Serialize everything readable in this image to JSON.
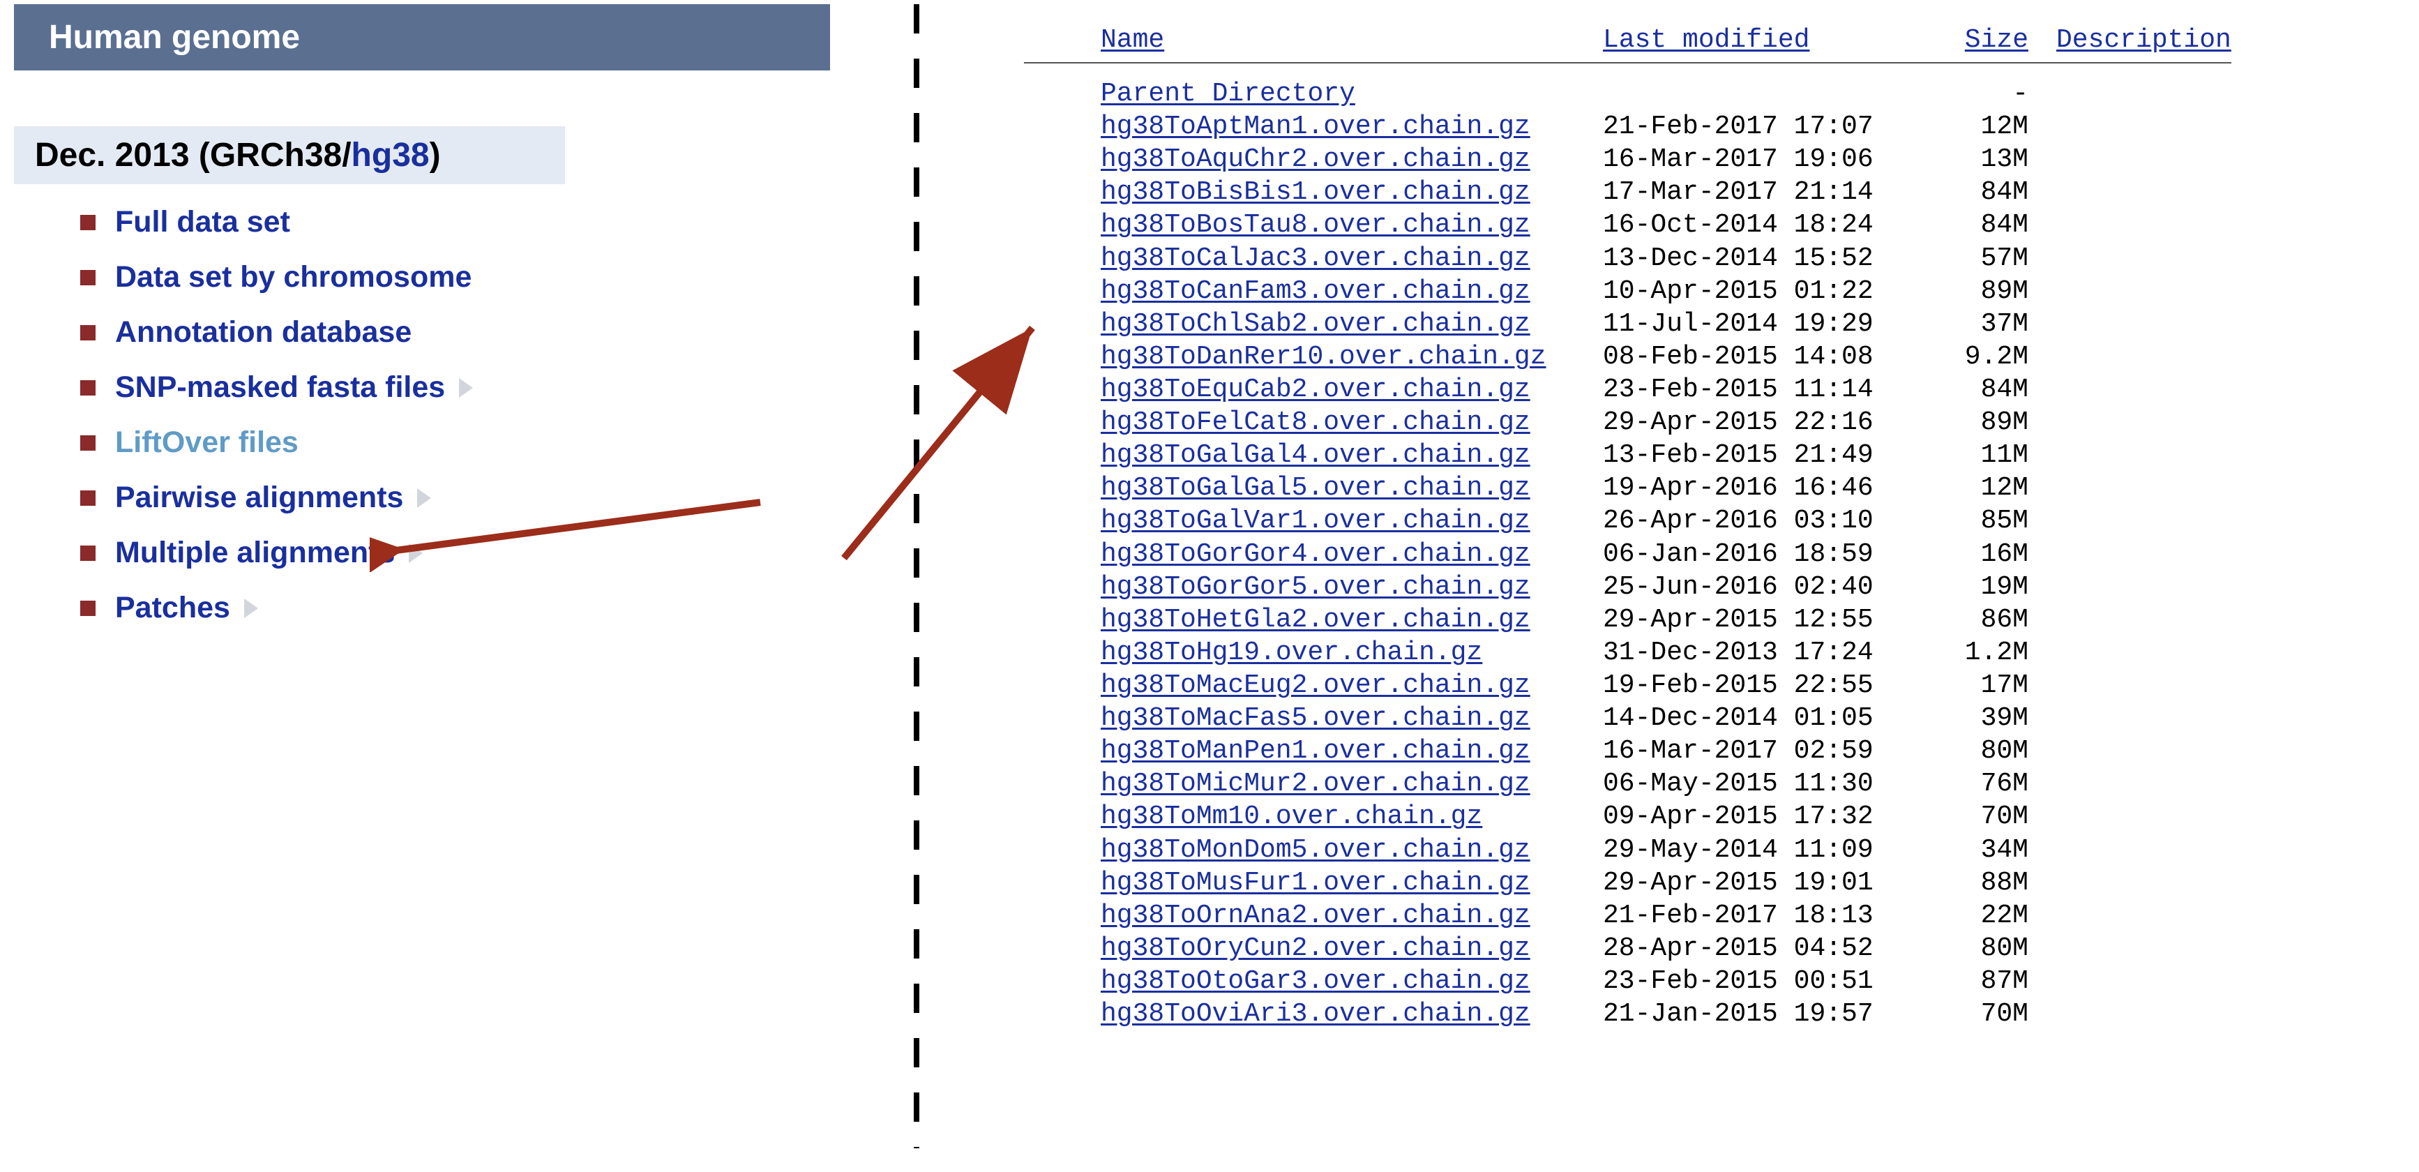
{
  "header": {
    "title": "Human genome"
  },
  "release": {
    "prefix": "Dec. 2013 (GRCh38/",
    "hg": "hg38",
    "suffix": ")"
  },
  "nav": {
    "items": [
      {
        "label": "Full data set",
        "chevron": false,
        "highlighted": false
      },
      {
        "label": "Data set by chromosome",
        "chevron": false,
        "highlighted": false
      },
      {
        "label": "Annotation database",
        "chevron": false,
        "highlighted": false
      },
      {
        "label": "SNP-masked fasta files",
        "chevron": true,
        "highlighted": false
      },
      {
        "label": "LiftOver files",
        "chevron": false,
        "highlighted": true
      },
      {
        "label": "Pairwise alignments",
        "chevron": true,
        "highlighted": false
      },
      {
        "label": "Multiple alignments",
        "chevron": true,
        "highlighted": false
      },
      {
        "label": "Patches",
        "chevron": true,
        "highlighted": false
      }
    ]
  },
  "dir": {
    "headers": {
      "name": "Name",
      "modified": "Last modified",
      "size": "Size",
      "desc": "Description"
    },
    "parent": "Parent Directory",
    "parent_size": "-",
    "files": [
      {
        "name": "hg38ToAptMan1.over.chain.gz",
        "modified": "21-Feb-2017 17:07",
        "size": "12M"
      },
      {
        "name": "hg38ToAquChr2.over.chain.gz",
        "modified": "16-Mar-2017 19:06",
        "size": "13M"
      },
      {
        "name": "hg38ToBisBis1.over.chain.gz",
        "modified": "17-Mar-2017 21:14",
        "size": "84M"
      },
      {
        "name": "hg38ToBosTau8.over.chain.gz",
        "modified": "16-Oct-2014 18:24",
        "size": "84M"
      },
      {
        "name": "hg38ToCalJac3.over.chain.gz",
        "modified": "13-Dec-2014 15:52",
        "size": "57M"
      },
      {
        "name": "hg38ToCanFam3.over.chain.gz",
        "modified": "10-Apr-2015 01:22",
        "size": "89M"
      },
      {
        "name": "hg38ToChlSab2.over.chain.gz",
        "modified": "11-Jul-2014 19:29",
        "size": "37M"
      },
      {
        "name": "hg38ToDanRer10.over.chain.gz",
        "modified": "08-Feb-2015 14:08",
        "size": "9.2M"
      },
      {
        "name": "hg38ToEquCab2.over.chain.gz",
        "modified": "23-Feb-2015 11:14",
        "size": "84M"
      },
      {
        "name": "hg38ToFelCat8.over.chain.gz",
        "modified": "29-Apr-2015 22:16",
        "size": "89M"
      },
      {
        "name": "hg38ToGalGal4.over.chain.gz",
        "modified": "13-Feb-2015 21:49",
        "size": "11M"
      },
      {
        "name": "hg38ToGalGal5.over.chain.gz",
        "modified": "19-Apr-2016 16:46",
        "size": "12M"
      },
      {
        "name": "hg38ToGalVar1.over.chain.gz",
        "modified": "26-Apr-2016 03:10",
        "size": "85M"
      },
      {
        "name": "hg38ToGorGor4.over.chain.gz",
        "modified": "06-Jan-2016 18:59",
        "size": "16M"
      },
      {
        "name": "hg38ToGorGor5.over.chain.gz",
        "modified": "25-Jun-2016 02:40",
        "size": "19M"
      },
      {
        "name": "hg38ToHetGla2.over.chain.gz",
        "modified": "29-Apr-2015 12:55",
        "size": "86M"
      },
      {
        "name": "hg38ToHg19.over.chain.gz",
        "modified": "31-Dec-2013 17:24",
        "size": "1.2M"
      },
      {
        "name": "hg38ToMacEug2.over.chain.gz",
        "modified": "19-Feb-2015 22:55",
        "size": "17M"
      },
      {
        "name": "hg38ToMacFas5.over.chain.gz",
        "modified": "14-Dec-2014 01:05",
        "size": "39M"
      },
      {
        "name": "hg38ToManPen1.over.chain.gz",
        "modified": "16-Mar-2017 02:59",
        "size": "80M"
      },
      {
        "name": "hg38ToMicMur2.over.chain.gz",
        "modified": "06-May-2015 11:30",
        "size": "76M"
      },
      {
        "name": "hg38ToMm10.over.chain.gz",
        "modified": "09-Apr-2015 17:32",
        "size": "70M"
      },
      {
        "name": "hg38ToMonDom5.over.chain.gz",
        "modified": "29-May-2014 11:09",
        "size": "34M"
      },
      {
        "name": "hg38ToMusFur1.over.chain.gz",
        "modified": "29-Apr-2015 19:01",
        "size": "88M"
      },
      {
        "name": "hg38ToOrnAna2.over.chain.gz",
        "modified": "21-Feb-2017 18:13",
        "size": "22M"
      },
      {
        "name": "hg38ToOryCun2.over.chain.gz",
        "modified": "28-Apr-2015 04:52",
        "size": "80M"
      },
      {
        "name": "hg38ToOtoGar3.over.chain.gz",
        "modified": "23-Feb-2015 00:51",
        "size": "87M"
      },
      {
        "name": "hg38ToOviAri3.over.chain.gz",
        "modified": "21-Jan-2015 19:57",
        "size": "70M"
      }
    ]
  },
  "arrow_color": "#9b2d1a"
}
